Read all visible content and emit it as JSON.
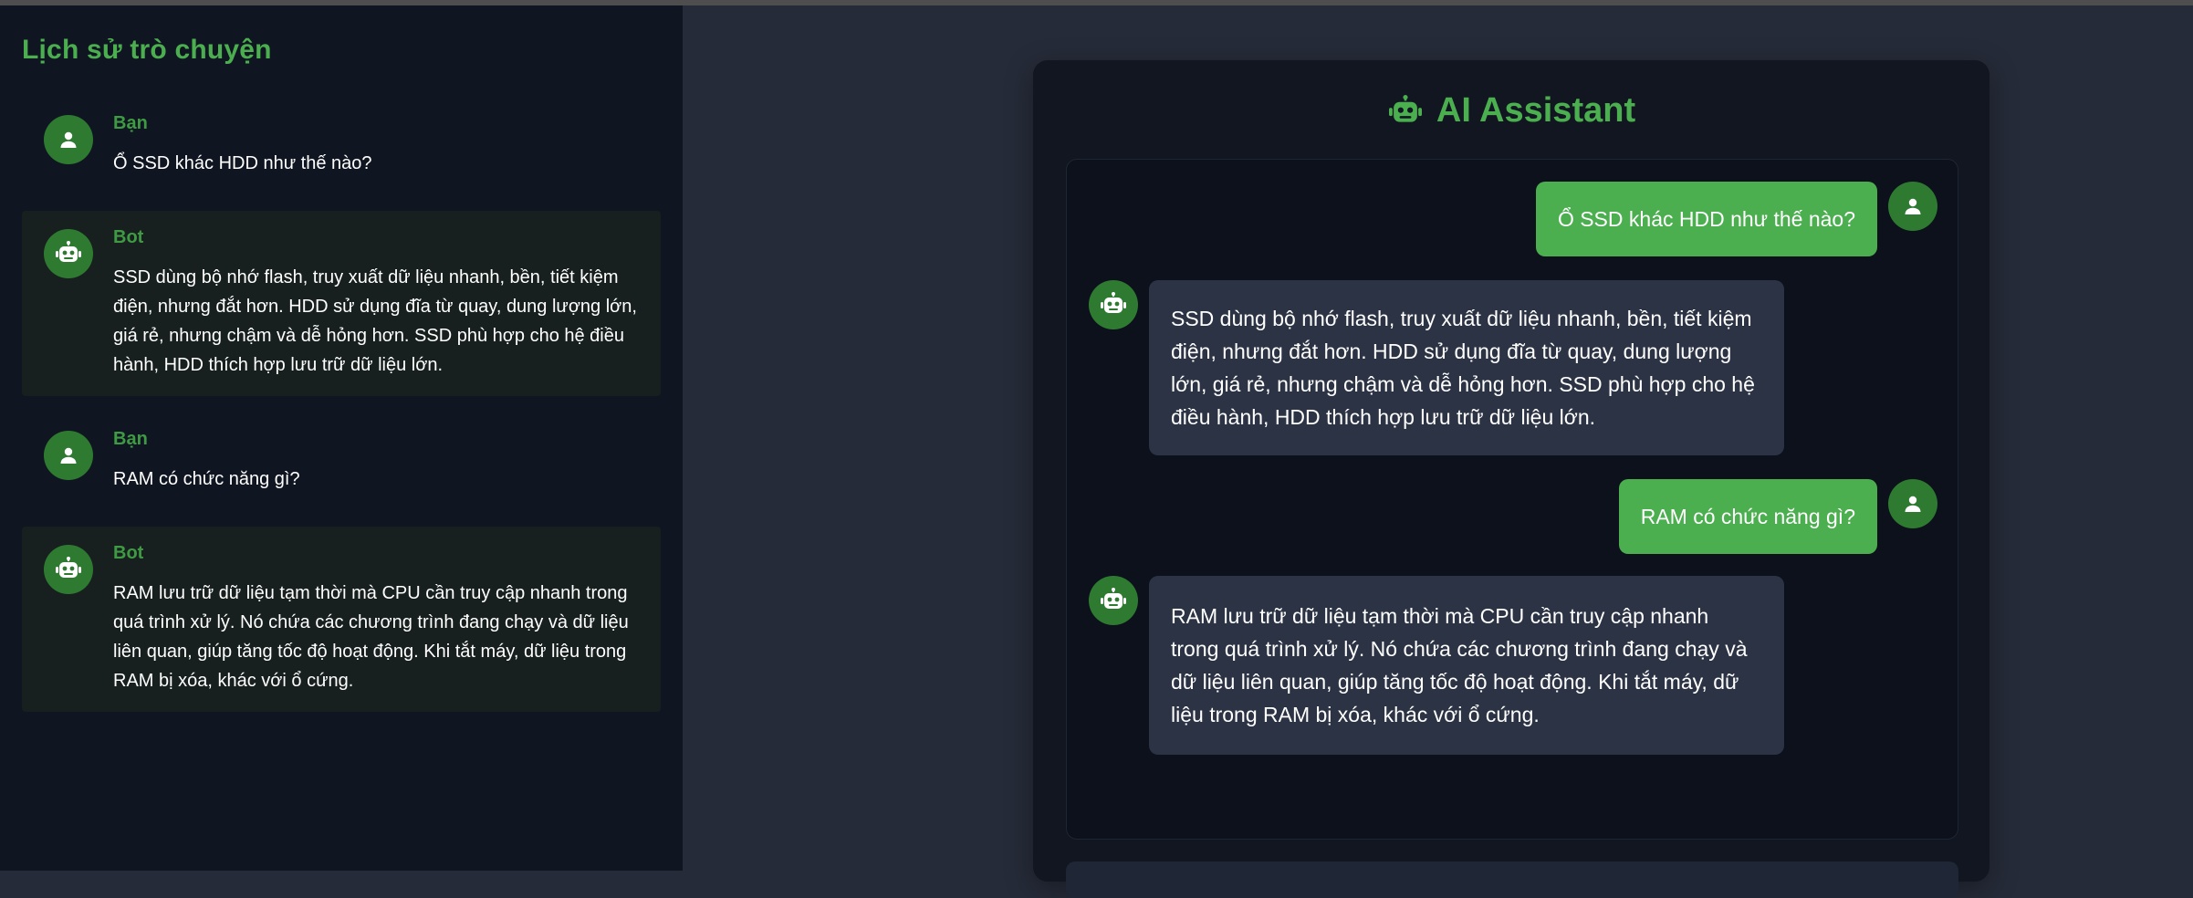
{
  "sidebar": {
    "title": "Lịch sử trò chuyện",
    "items": [
      {
        "role": "user",
        "name": "Bạn",
        "text": "Ổ SSD khác HDD như thế nào?"
      },
      {
        "role": "bot",
        "name": "Bot",
        "text": "SSD dùng bộ nhớ flash, truy xuất dữ liệu nhanh, bền, tiết kiệm điện, nhưng đắt hơn. HDD sử dụng đĩa từ quay, dung lượng lớn, giá rẻ, nhưng chậm và dễ hỏng hơn. SSD phù hợp cho hệ điều hành, HDD thích hợp lưu trữ dữ liệu lớn."
      },
      {
        "role": "user",
        "name": "Bạn",
        "text": "RAM có chức năng gì?"
      },
      {
        "role": "bot",
        "name": "Bot",
        "text": "RAM lưu trữ dữ liệu tạm thời mà CPU cần truy cập nhanh trong quá trình xử lý. Nó chứa các chương trình đang chạy và dữ liệu liên quan, giúp tăng tốc độ hoạt động. Khi tắt máy, dữ liệu trong RAM bị xóa, khác với ổ cứng."
      }
    ]
  },
  "main": {
    "title": "AI Assistant",
    "messages": [
      {
        "role": "user",
        "text": "Ổ SSD khác HDD như thế nào?"
      },
      {
        "role": "bot",
        "text": "SSD dùng bộ nhớ flash, truy xuất dữ liệu nhanh, bền, tiết kiệm điện, nhưng đắt hơn. HDD sử dụng đĩa từ quay, dung lượng lớn, giá rẻ, nhưng chậm và dễ hỏng hơn. SSD phù hợp cho hệ điều hành, HDD thích hợp lưu trữ dữ liệu lớn."
      },
      {
        "role": "user",
        "text": "RAM có chức năng gì?"
      },
      {
        "role": "bot",
        "text": "RAM lưu trữ dữ liệu tạm thời mà CPU cần truy cập nhanh trong quá trình xử lý. Nó chứa các chương trình đang chạy và dữ liệu liên quan, giúp tăng tốc độ hoạt động. Khi tắt máy, dữ liệu trong RAM bị xóa, khác với ổ cứng."
      }
    ]
  },
  "icons": {
    "user": "user-icon",
    "bot": "robot-icon"
  },
  "colors": {
    "accent": "#4bae4f",
    "avatar_bg": "#2f7a31",
    "sidebar_bg": "#101621",
    "page_bg": "#262b39",
    "card_bg": "#111620",
    "bot_bubble": "#2c3344"
  }
}
